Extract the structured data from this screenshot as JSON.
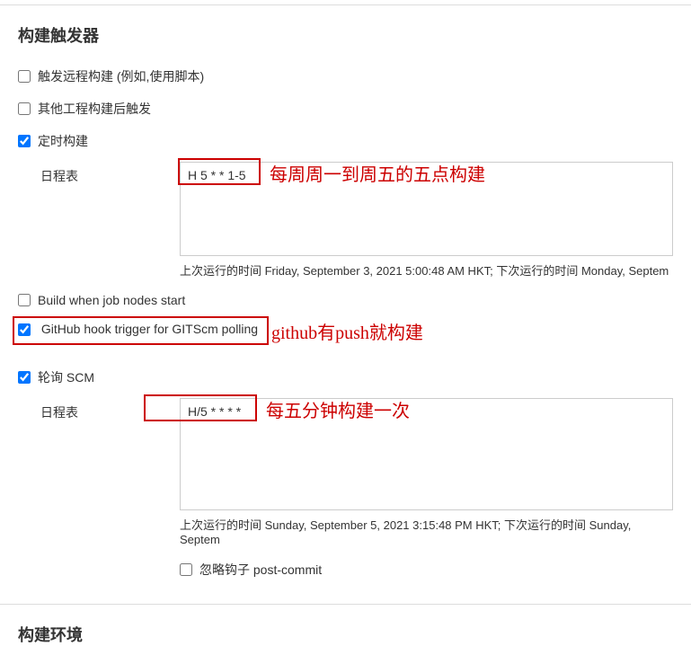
{
  "sections": {
    "build_triggers": {
      "title": "构建触发器"
    },
    "build_env": {
      "title": "构建环境"
    }
  },
  "triggers": {
    "remote": {
      "label": "触发远程构建 (例如,使用脚本)",
      "checked": false
    },
    "after_other": {
      "label": "其他工程构建后触发",
      "checked": false
    },
    "timed": {
      "label": "定时构建",
      "checked": true,
      "schedule_label": "日程表",
      "schedule_value": "H 5 * * 1-5",
      "status": "上次运行的时间 Friday, September 3, 2021 5:00:48 AM HKT; 下次运行的时间 Monday, Septem",
      "annotation": "每周周一到周五的五点构建"
    },
    "job_nodes": {
      "label": "Build when job nodes start",
      "checked": false
    },
    "github_hook": {
      "label": "GitHub hook trigger for GITScm polling",
      "checked": true,
      "annotation": "github有push就构建"
    },
    "poll_scm": {
      "label": "轮询 SCM",
      "checked": true,
      "schedule_label": "日程表",
      "schedule_value": "H/5 * * * *",
      "status": "上次运行的时间 Sunday, September 5, 2021 3:15:48 PM HKT; 下次运行的时间 Sunday, Septem",
      "annotation": "每五分钟构建一次",
      "ignore_hooks_label": "忽略钩子 post-commit",
      "ignore_hooks_checked": false
    }
  }
}
